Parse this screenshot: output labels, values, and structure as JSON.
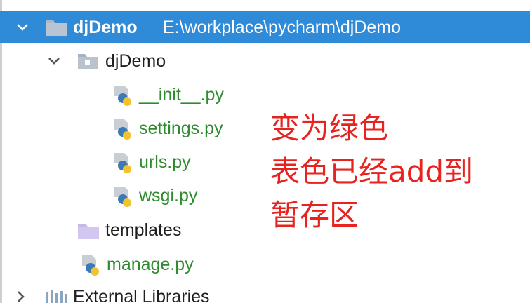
{
  "project_tree": {
    "root": {
      "name": "djDemo",
      "path": "E:\\workplace\\pycharm\\djDemo"
    },
    "package": {
      "name": "djDemo",
      "files": [
        {
          "name": "__init__.py"
        },
        {
          "name": "settings.py"
        },
        {
          "name": "urls.py"
        },
        {
          "name": "wsgi.py"
        }
      ]
    },
    "templates": {
      "name": "templates"
    },
    "manage": {
      "name": "manage.py"
    },
    "external_libraries": {
      "name": "External Libraries"
    }
  },
  "annotation": {
    "line1": "变为绿色",
    "line2": "表色已经add到",
    "line3": "暂存区"
  },
  "colors": {
    "selection": "#2f8ad8",
    "git_added_green": "#2e8b2e",
    "annotation_red": "#e8231f"
  },
  "icons": {
    "root_expand": "chevron-down-icon",
    "package_expand": "chevron-down-icon",
    "external_expand": "chevron-right-icon",
    "folder": "folder-icon",
    "python_file": "python-file-icon",
    "library": "library-icon"
  }
}
